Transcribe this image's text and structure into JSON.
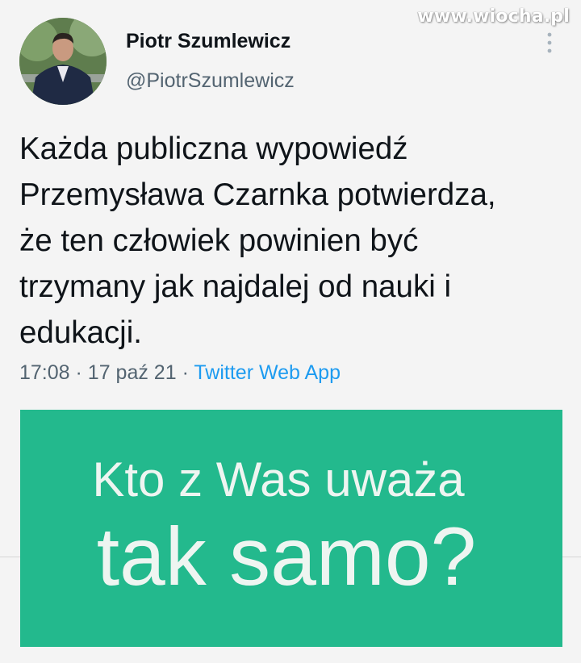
{
  "watermark": "www.wiocha.pl",
  "author": {
    "name": "Piotr Szumlewicz",
    "handle": "@PiotrSzumlewicz"
  },
  "tweet": {
    "lines": [
      "Każda publiczna wypowiedź",
      "Przemysława Czarnka potwierdza,",
      "że ten człowiek powinien być",
      "trzymany jak najdalej od nauki i",
      "edukacji."
    ],
    "time": "17:08",
    "date": "17 paź 21",
    "separator": "·",
    "source": "Twitter Web App"
  },
  "card": {
    "line1": "Kto z Was uważa",
    "line2": "tak samo?"
  },
  "colors": {
    "card_background": "#23b98d",
    "source_link": "#1d9bf0",
    "secondary_text": "#536471"
  },
  "icons": {
    "more": "more-vertical-icon"
  }
}
